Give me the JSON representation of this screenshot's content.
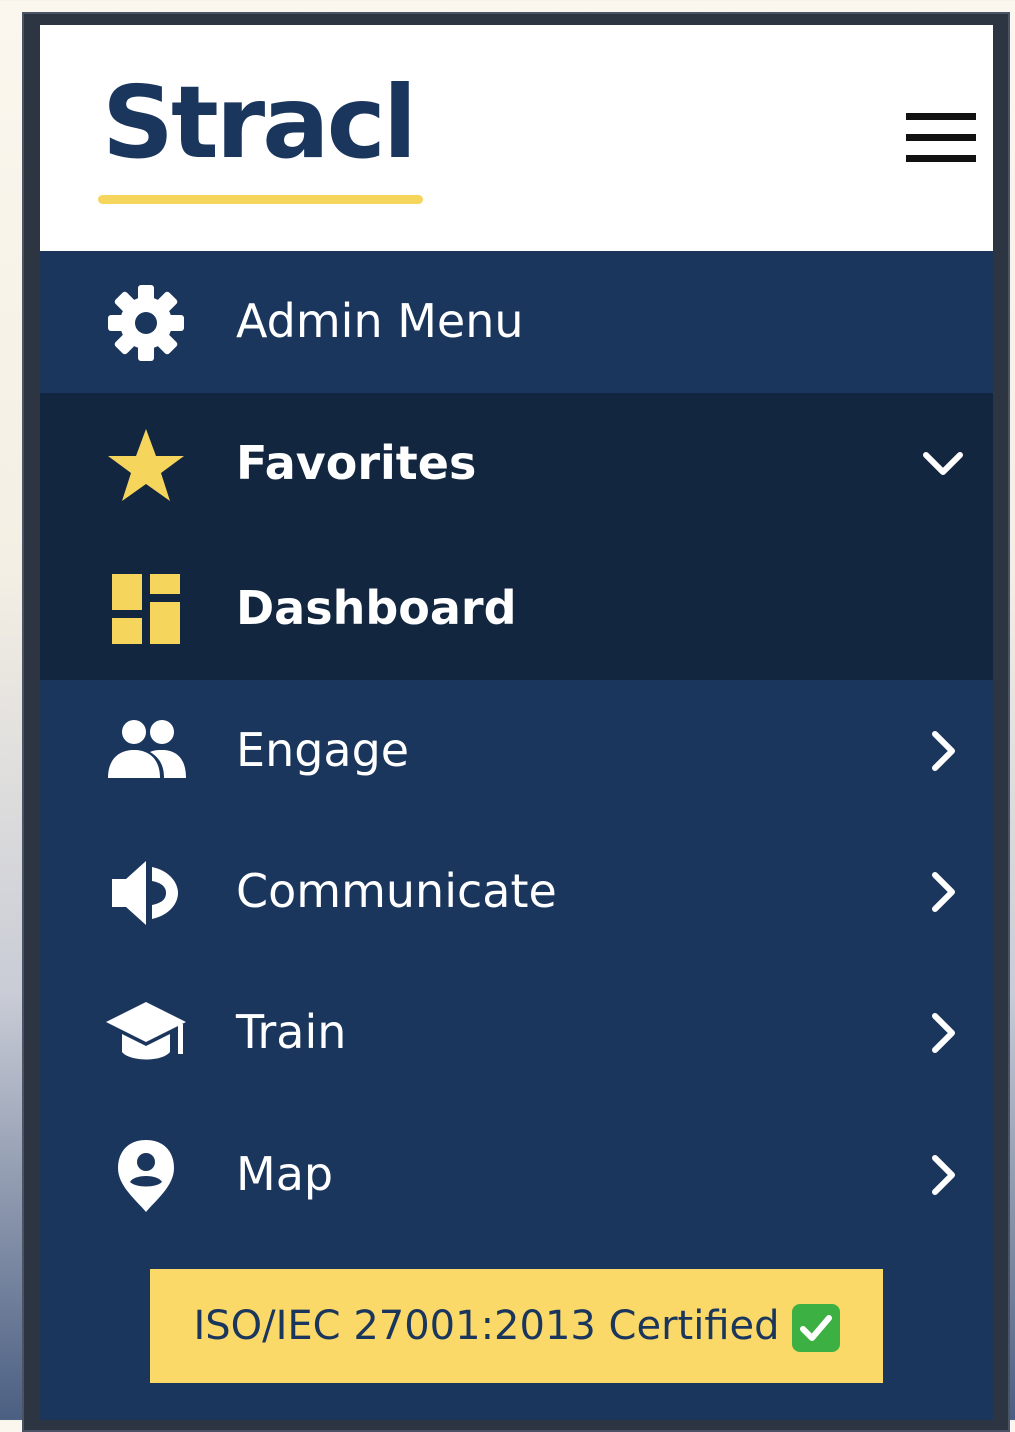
{
  "brand": {
    "logo_text": "Stracl",
    "primary": "#1b365d",
    "accent": "#f6d55c"
  },
  "header": {
    "menu_icon": "hamburger-menu-icon"
  },
  "menu": {
    "admin": {
      "label": "Admin Menu",
      "icon": "gear-icon"
    },
    "favorites": {
      "label": "Favorites",
      "icon": "star-icon",
      "state": "expanded",
      "chevron": "chevron-down-icon"
    },
    "dashboard": {
      "label": "Dashboard",
      "icon": "dashboard-icon"
    },
    "engage": {
      "label": "Engage",
      "icon": "people-icon",
      "chevron": "chevron-right-icon"
    },
    "communicate": {
      "label": "Communicate",
      "icon": "speaker-icon",
      "chevron": "chevron-right-icon"
    },
    "train": {
      "label": "Train",
      "icon": "graduation-cap-icon",
      "chevron": "chevron-right-icon"
    },
    "map": {
      "label": "Map",
      "icon": "map-pin-icon",
      "chevron": "chevron-right-icon"
    }
  },
  "badge": {
    "text": "ISO/IEC 27001:2013 Certified",
    "icon": "check-mark-icon",
    "color": "#fbd968"
  }
}
